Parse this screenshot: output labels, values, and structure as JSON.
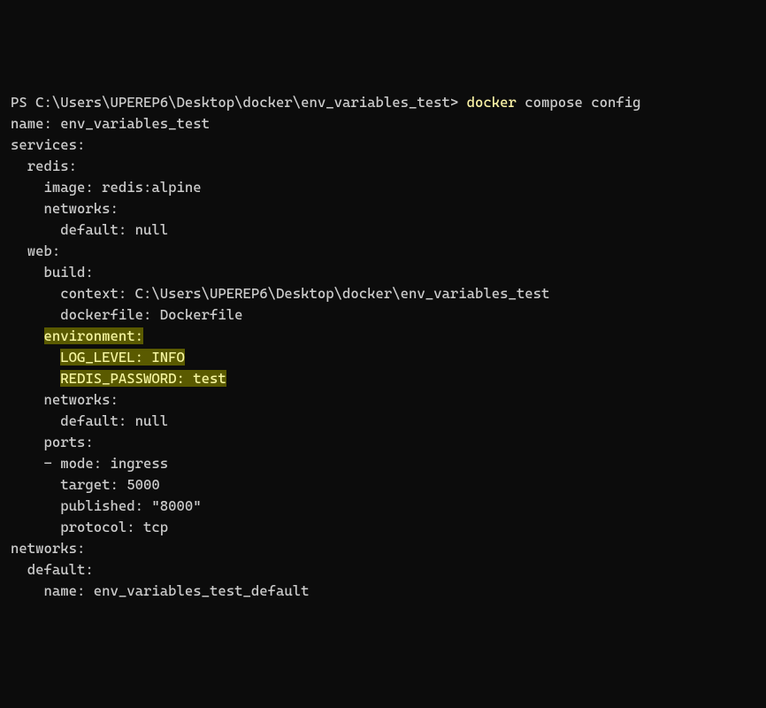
{
  "prompt": {
    "prefix": "PS ",
    "path": "C:\\Users\\UPEREP6\\Desktop\\docker\\env_variables_test",
    "separator": "> ",
    "command_highlighted": "docker",
    "command_rest": " compose config"
  },
  "output": {
    "l01": "name: env_variables_test",
    "l02": "services:",
    "l03": "  redis:",
    "l04": "    image: redis:alpine",
    "l05": "    networks:",
    "l06": "      default: null",
    "l07": "  web:",
    "l08": "    build:",
    "l09": "      context: C:\\Users\\UPEREP6\\Desktop\\docker\\env_variables_test",
    "l10": "      dockerfile: Dockerfile",
    "l11_indent": "    ",
    "l11_hl": "environment:",
    "l12_indent": "      ",
    "l12_hl": "LOG_LEVEL: INFO",
    "l13_indent": "      ",
    "l13_hl": "REDIS_PASSWORD: test",
    "l14": "    networks:",
    "l15": "      default: null",
    "l16": "    ports:",
    "l17": "    - mode: ingress",
    "l18": "      target: 5000",
    "l19": "      published: \"8000\"",
    "l20": "      protocol: tcp",
    "l21": "networks:",
    "l22": "  default:",
    "l23": "    name: env_variables_test_default"
  }
}
